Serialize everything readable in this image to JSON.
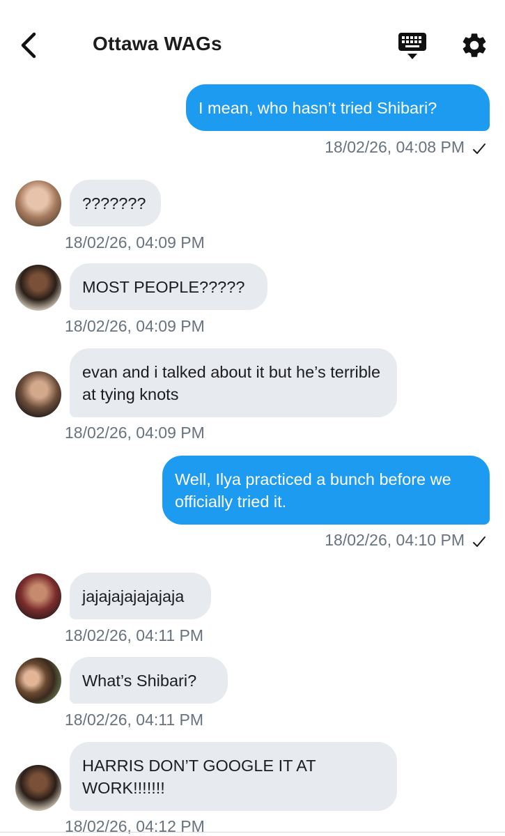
{
  "header": {
    "title": "Ottawa WAGs",
    "back_icon": "chevron-left-icon",
    "keyboard_icon": "keyboard-icon",
    "settings_icon": "gear-icon"
  },
  "colors": {
    "outgoing_bubble": "#1d9bf0",
    "incoming_bubble": "#e7eaee",
    "timestamp": "#67737f"
  },
  "messages": [
    {
      "direction": "out",
      "text": "I mean, who hasn’t tried Shibari?",
      "timestamp": "18/02/26, 04:08 PM",
      "status_icon": "checkmark-icon"
    },
    {
      "direction": "in",
      "text": "???????",
      "timestamp": "18/02/26, 04:09 PM",
      "avatar": "avatar-1"
    },
    {
      "direction": "in",
      "text": "MOST PEOPLE?????",
      "timestamp": "18/02/26, 04:09 PM",
      "avatar": "avatar-2"
    },
    {
      "direction": "in",
      "text": "evan and i talked about it but he’s terrible at tying knots",
      "timestamp": "18/02/26, 04:09 PM",
      "avatar": "avatar-3"
    },
    {
      "direction": "out",
      "text": "Well, Ilya practiced a bunch before we officially tried it.",
      "timestamp": "18/02/26, 04:10 PM",
      "status_icon": "checkmark-icon"
    },
    {
      "direction": "in",
      "text": "jajajajajajajaja",
      "timestamp": "18/02/26, 04:11 PM",
      "avatar": "avatar-4"
    },
    {
      "direction": "in",
      "text": "What’s Shibari?",
      "timestamp": "18/02/26, 04:11 PM",
      "avatar": "avatar-5"
    },
    {
      "direction": "in",
      "text": "HARRIS DON’T GOOGLE IT AT WORK!!!!!!!",
      "timestamp": "18/02/26, 04:12 PM",
      "avatar": "avatar-2"
    }
  ]
}
